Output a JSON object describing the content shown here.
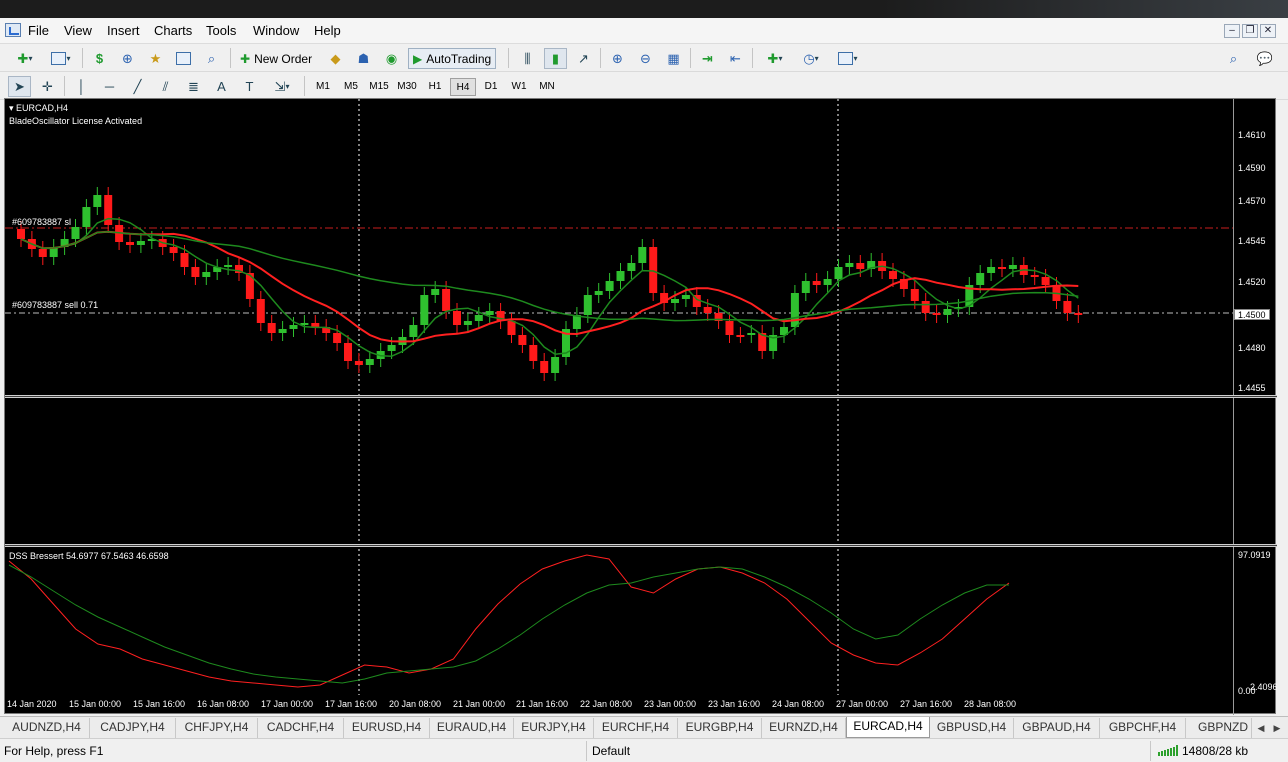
{
  "menu": [
    "File",
    "View",
    "Insert",
    "Charts",
    "Tools",
    "Window",
    "Help"
  ],
  "toolbar": {
    "new_order": "New Order",
    "autotrading": "AutoTrading"
  },
  "timeframes": [
    "M1",
    "M5",
    "M15",
    "M30",
    "H1",
    "H4",
    "D1",
    "W1",
    "MN"
  ],
  "active_timeframe": "H4",
  "chart": {
    "symbol_title": "EURCAD,H4",
    "license_text": "BladeOscillator License Activated",
    "sl_label": "#609783887 sl",
    "sell_label": "#609783887 sell 0.71",
    "current_price": "1.4500",
    "price_ticks": [
      "1.4610",
      "1.4590",
      "1.4570",
      "1.4545",
      "1.4520",
      "1.4480",
      "1.4455"
    ],
    "indicator_label": "DSS Bressert 54.6977 67.5463 46.6598",
    "indicator_max": "97.0919",
    "indicator_min": "0.00",
    "indicator_min2": "2.4096",
    "time_labels": [
      "14 Jan 2020",
      "15 Jan 00:00",
      "15 Jan 16:00",
      "16 Jan 08:00",
      "17 Jan 00:00",
      "17 Jan 16:00",
      "20 Jan 08:00",
      "21 Jan 00:00",
      "21 Jan 16:00",
      "22 Jan 08:00",
      "23 Jan 00:00",
      "23 Jan 16:00",
      "24 Jan 08:00",
      "27 Jan 00:00",
      "27 Jan 16:00",
      "28 Jan 08:00"
    ],
    "colors": {
      "bull": "#2fc02f",
      "bear": "#ff1a1a",
      "ma_fast": "#ff2020",
      "ma_slow": "#1e8a1e",
      "sl_line": "#c81e1e"
    }
  },
  "tabs": [
    "AUDNZD,H4",
    "CADJPY,H4",
    "CHFJPY,H4",
    "CADCHF,H4",
    "EURUSD,H4",
    "EURAUD,H4",
    "EURJPY,H4",
    "EURCHF,H4",
    "EURGBP,H4",
    "EURNZD,H4",
    "EURCAD,H4",
    "GBPUSD,H4",
    "GBPAUD,H4",
    "GBPCHF,H4",
    "GBPNZD"
  ],
  "active_tab": "EURCAD,H4",
  "status": {
    "help": "For Help, press F1",
    "profile": "Default",
    "traffic": "14808/28 kb"
  }
}
